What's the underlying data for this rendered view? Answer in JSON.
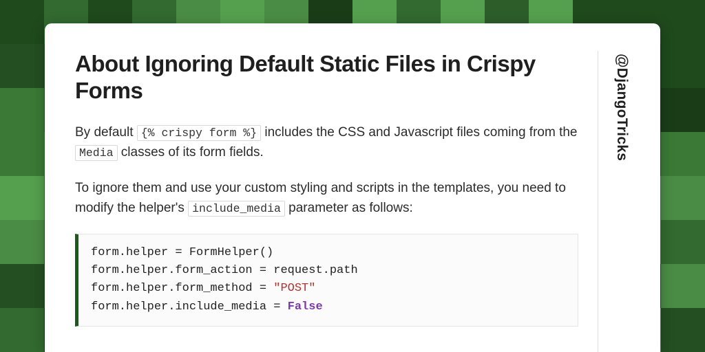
{
  "heading": "About Ignoring Default Static Files in Crispy Forms",
  "para1_parts": {
    "a": "By default ",
    "code1": "{% crispy form %}",
    "b": " includes the CSS and Javascript files coming from the ",
    "code2": "Media",
    "c": " classes of its form fields."
  },
  "para2_parts": {
    "a": "To ignore them and use your custom styling and scripts in the templates, you need to modify the helper's ",
    "code1": "include_media",
    "b": " parameter as follows:"
  },
  "code": {
    "l1": "form.helper = FormHelper()",
    "l2": "form.helper.form_action = request.path",
    "l3a": "form.helper.form_method = ",
    "l3b": "\"POST\"",
    "l4a": "form.helper.include_media = ",
    "l4b": "False"
  },
  "handle": "@DjangoTricks",
  "bg_palette": [
    "#1a3d18",
    "#244f22",
    "#2d5e2a",
    "#3a7a36",
    "#4a8c45",
    "#55a04f",
    "#326a2f",
    "#1e4a1c"
  ]
}
